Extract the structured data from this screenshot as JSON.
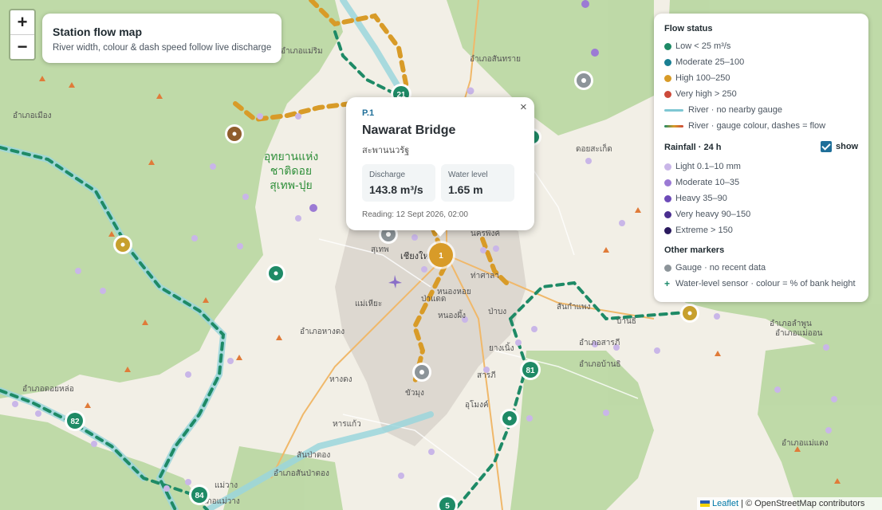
{
  "zoom": {
    "in_label": "+",
    "out_label": "−"
  },
  "title_card": {
    "title": "Station flow map",
    "subtitle": "River width, colour & dash speed follow live discharge"
  },
  "colors": {
    "low": "#1e8a66",
    "moderate": "#1a7f93",
    "high": "#d89b28",
    "very_high": "#cc4a3a",
    "river": "#9bd6dc",
    "gauge_no_data": "#8c9499",
    "rain_light": "#c9b6e8",
    "rain_moderate": "#9b7ad4",
    "rain_heavy": "#6d4bb8",
    "rain_very_heavy": "#4a2f8f",
    "rain_extreme": "#2a1a5e",
    "sensor": "#1a8a6a"
  },
  "legend": {
    "flow_title": "Flow status",
    "flow_items": [
      {
        "label": "Low < 25 m³/s",
        "color": "#1e8a66"
      },
      {
        "label": "Moderate 25–100",
        "color": "#1a7f93"
      },
      {
        "label": "High 100–250",
        "color": "#d89b28"
      },
      {
        "label": "Very high > 250",
        "color": "#cc4a3a"
      }
    ],
    "river_no_gauge": "River · no nearby gauge",
    "river_gauge": "River · gauge colour, dashes = flow",
    "rain_title": "Rainfall · 24 h",
    "rain_toggle_label": "show",
    "rain_toggle_checked": true,
    "rain_items": [
      {
        "label": "Light 0.1–10 mm",
        "color": "#c9b6e8"
      },
      {
        "label": "Moderate 10–35",
        "color": "#9b7ad4"
      },
      {
        "label": "Heavy 35–90",
        "color": "#6d4bb8"
      },
      {
        "label": "Very heavy 90–150",
        "color": "#4a2f8f"
      },
      {
        "label": "Extreme > 150",
        "color": "#2a1a5e"
      }
    ],
    "other_title": "Other markers",
    "gauge_no_data": "Gauge · no recent data",
    "sensor_symbol": "+",
    "sensor_label": "Water-level sensor · colour = % of bank height"
  },
  "popup": {
    "code": "P.1",
    "name": "Nawarat Bridge",
    "name_thai": "สะพานนวรัฐ",
    "discharge_label": "Discharge",
    "discharge_value": "143.8 m³/s",
    "level_label": "Water level",
    "level_value": "1.65 m",
    "reading": "Reading: 12 Sept 2026, 02:00",
    "close": "×"
  },
  "markers": {
    "selected_station": "1",
    "clusters": [
      {
        "label": "21",
        "color": "#1e8a66"
      },
      {
        "label": "81",
        "color": "#1e8a66"
      },
      {
        "label": "82",
        "color": "#1e8a66"
      },
      {
        "label": "84",
        "color": "#1e8a66"
      },
      {
        "label": "5",
        "color": "#1e8a66"
      }
    ]
  },
  "place_labels": {
    "park": [
      "อุทยานแห่ง",
      "ชาติดอย",
      "สุเทพ-ปุย"
    ],
    "towns": [
      "อำเภอแม่ริม",
      "อำเภอสันทราย",
      "อำเภอเมือง",
      "ดอยสะเก็ด",
      "สุเทพ",
      "เชียงใหม่",
      "นครพิงค์",
      "ท่าศาลา",
      "แม่เหียะ",
      "ป่าแดด",
      "หนองหอย",
      "หนองผึ้ง",
      "ป่าบง",
      "สันกำแพง",
      "อำเภอหางดง",
      "ยางเนิ้ง",
      "สารภี",
      "หางดง",
      "ขัวมุง",
      "อุโมงค์",
      "หารแก้ว",
      "สันป่าตอง",
      "อำเภอสันป่าตอง",
      "แม่วาง",
      "อำเภอแม่วาง",
      "อำเภอลำพูน",
      "อำเภอแม่ออน",
      "บ้านธิ",
      "อำเภอบ้านธิ",
      "อำเภอสารภี",
      "อำเภอดอยหล่อ",
      "อำเภอแม่แตง"
    ]
  },
  "attribution": {
    "leaflet": "Leaflet",
    "separator": " | © ",
    "osm": "OpenStreetMap contributors"
  }
}
